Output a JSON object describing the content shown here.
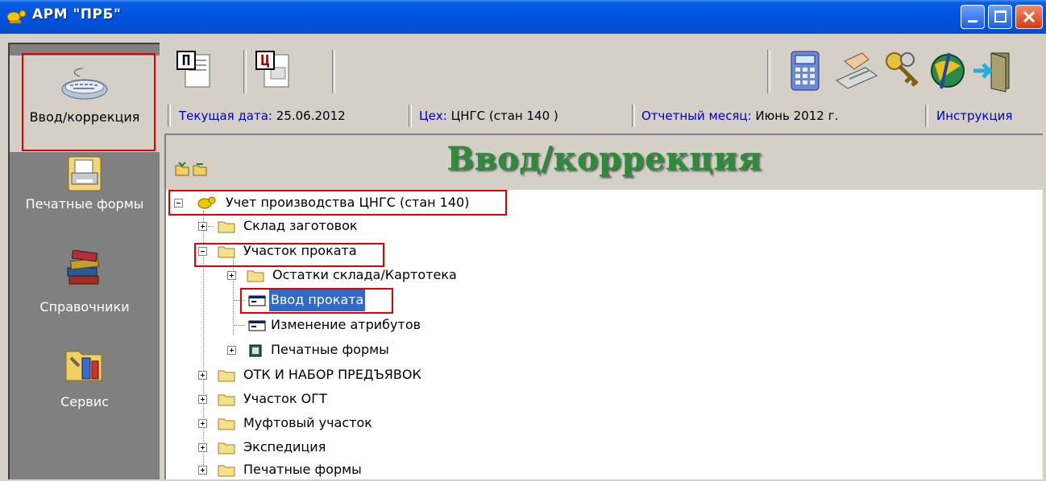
{
  "window": {
    "title": "АРМ \"ПРБ\""
  },
  "sidebar": {
    "items": [
      {
        "label": "Ввод/коррекция",
        "icon": "keyboard-icon"
      },
      {
        "label": "Печатные формы",
        "icon": "printer-icon"
      },
      {
        "label": "Справочники",
        "icon": "books-icon"
      },
      {
        "label": "Сервис",
        "icon": "tools-folder-icon"
      }
    ]
  },
  "toolbar": {
    "left_buttons": [
      {
        "letter": "П",
        "icon": "document-p-icon"
      },
      {
        "letter": "Ц",
        "icon": "document-c-icon"
      }
    ],
    "right_buttons": [
      "calculator-icon",
      "keyboard-hand-icon",
      "keys-icon",
      "globe-icon",
      "exit-door-icon"
    ]
  },
  "status": {
    "date_label": "Текущая дата:",
    "date_value": "25.06.2012",
    "shop_label": "Цех:",
    "shop_value": "ЦНГС (стан 140 )",
    "month_label": "Отчетный месяц:",
    "month_value": "Июнь 2012 г.",
    "instruction": "Инструкция"
  },
  "content": {
    "title": "Ввод/коррекция"
  },
  "tree": {
    "root": "Учет производства ЦНГС (стан 140)",
    "items": [
      "Склад заготовок",
      "Участок проката",
      "Остатки склада/Картотека",
      "Ввод проката",
      "Изменение атрибутов",
      "Печатные формы",
      "ОТК И НАБОР ПРЕДЪЯВОК",
      "Участок ОГТ",
      "Муфтовый участок",
      "Экспедиция",
      "Печатные формы"
    ]
  },
  "colors": {
    "title_bar": "#0054e3",
    "highlight_box": "#e00000",
    "selection": "#316ac5",
    "heading_green": "#2e8b3a"
  }
}
